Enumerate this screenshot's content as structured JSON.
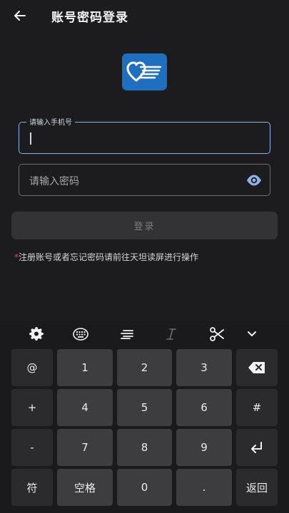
{
  "header": {
    "title": "账号密码登录"
  },
  "form": {
    "phone_label": "请输入手机号",
    "password_placeholder": "请输入密码",
    "login_label": "登录"
  },
  "note": {
    "star": "*",
    "text": "注册账号或者忘记密码请前往天坦读屏进行操作"
  },
  "keyboard": {
    "toolbar": [
      "gear-icon",
      "keyboard-icon",
      "align-icon",
      "italic-icon",
      "scissors-icon",
      "chevron-down-icon"
    ],
    "rows": [
      [
        "@",
        "1",
        "2",
        "3",
        "⌫"
      ],
      [
        "+",
        "4",
        "5",
        "6",
        "#"
      ],
      [
        "-",
        "7",
        "8",
        "9",
        "↵"
      ],
      [
        "符",
        "空格",
        "0",
        ".",
        "返回"
      ]
    ]
  },
  "colors": {
    "background": "#1c1c1e",
    "accent_border": "#8fb0e6",
    "logo_blue": "#1f6fc1",
    "note_star": "#e04a4a"
  }
}
